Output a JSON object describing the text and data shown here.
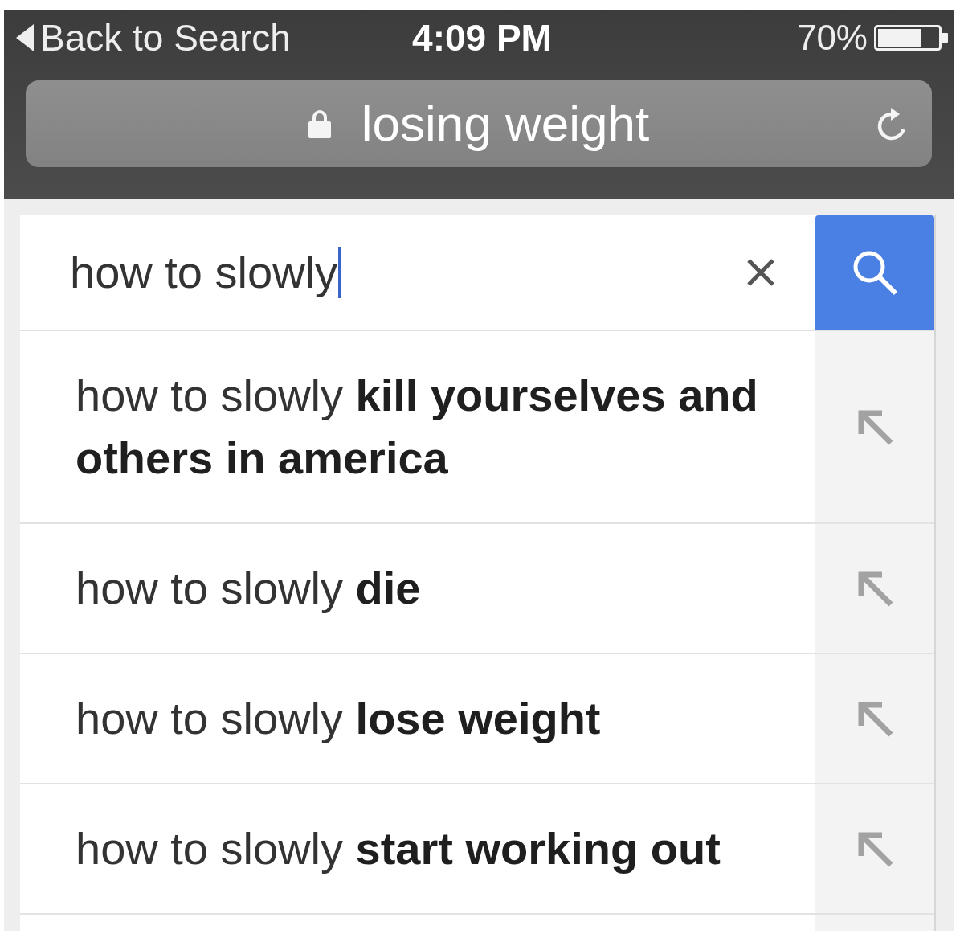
{
  "status_bar": {
    "back_label": "Back to Search",
    "time": "4:09 PM",
    "battery_text": "70%"
  },
  "address_bar": {
    "secure": true,
    "text": "losing weight"
  },
  "search": {
    "value": "how to slowly",
    "focused": true
  },
  "suggestions": [
    {
      "text": "how to slowly **kill yourselves and others in america**"
    },
    {
      "text": "how to slowly **die**"
    },
    {
      "text": "how to slowly **lose weight**"
    },
    {
      "text": "how to slowly **start working out**"
    }
  ]
}
